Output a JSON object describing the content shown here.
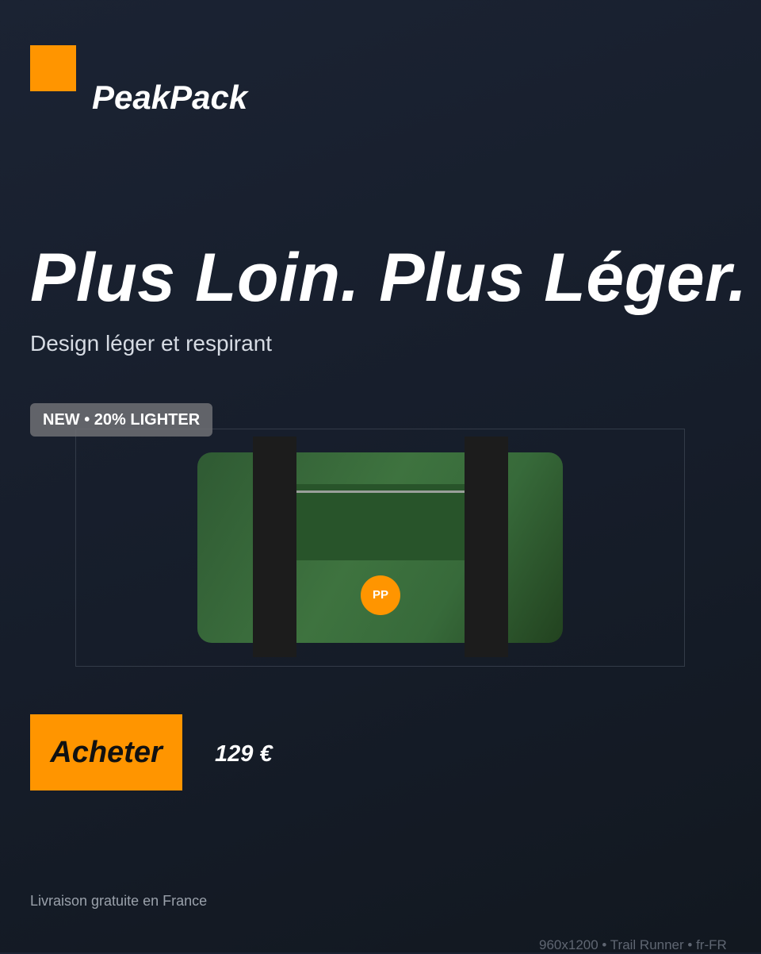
{
  "brand": {
    "name": "PeakPack",
    "logo_color": "#ff9500"
  },
  "hero": {
    "headline": "Plus Loin. Plus Léger.",
    "subtitle": "Design léger et respirant"
  },
  "badge": {
    "text": "NEW • 20% LIGHTER"
  },
  "product": {
    "logo_text": "PP",
    "body_color": "#3e733f",
    "strap_color": "#1c1c1c"
  },
  "cta": {
    "button_label": "Acheter",
    "price": "129 €",
    "accent_color": "#ff9500"
  },
  "footer": {
    "shipping_note": "Livraison gratuite en France",
    "meta": "960x1200 • Trail Runner • fr-FR"
  }
}
